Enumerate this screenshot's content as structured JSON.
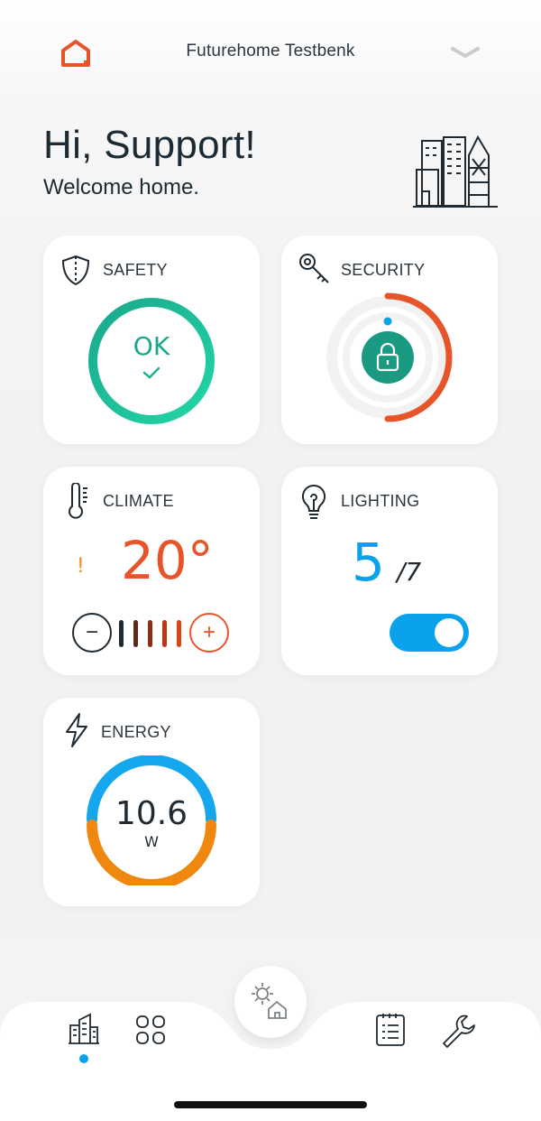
{
  "header": {
    "home_name": "Futurehome Testbenk"
  },
  "greeting": {
    "title": "Hi, Support!",
    "subtitle": "Welcome home."
  },
  "cards": {
    "safety": {
      "label": "SAFETY",
      "status": "OK"
    },
    "security": {
      "label": "SECURITY"
    },
    "climate": {
      "label": "CLIMATE",
      "temperature": "20°",
      "warning": "!"
    },
    "lighting": {
      "label": "LIGHTING",
      "on_count": "5",
      "total": "/7",
      "toggle_on": true
    },
    "energy": {
      "label": "ENERGY",
      "value": "10.6",
      "unit": "W"
    }
  },
  "colors": {
    "accent_orange": "#e8542a",
    "teal": "#1db592",
    "blue": "#0aa2ea",
    "energy_orange": "#f0870f"
  },
  "nav": {
    "items": [
      "home-icon",
      "grid-icon",
      "mode-icon",
      "list-icon",
      "wrench-icon"
    ],
    "active": "home-icon"
  }
}
